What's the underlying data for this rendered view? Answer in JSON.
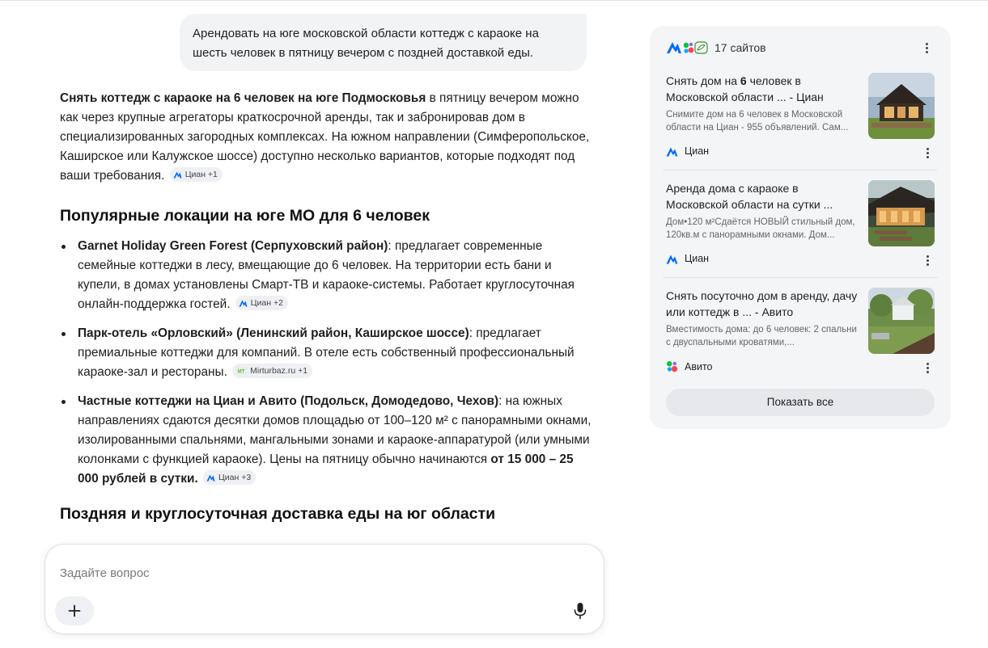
{
  "user_message": "Арендовать на юге московской области коттедж с караоке на шесть человек в пятницу вечером с поздней доставкой еды.",
  "answer": {
    "intro_bold": "Снять коттедж с караоке на 6 человек на юге Подмосковья",
    "intro_text": " в пятницу вечером можно как через крупные агрегаторы краткосрочной аренды, так и забронировав дом в специализированных загородных комплексах. На южном направлении (Симферопольское, Каширское или Калужское шоссе) доступно несколько вариантов, которые подходят под ваши требования.",
    "intro_chip": "Циан +1",
    "section1_title": "Популярные локации на юге МО для 6 человек",
    "items": [
      {
        "bold": "Garnet Holiday Green Forest (Серпуховский район)",
        "text": ": предлагает современные семейные коттеджи в лесу, вмещающие до 6 человек. На территории есть бани и купели, в домах установлены Смарт-ТВ и караоке-системы. Работает круглосуточная онлайн-поддержка гостей.",
        "chip": "Циан +2",
        "chip_icon": "cian-logo-icon"
      },
      {
        "bold": "Парк-отель «Орловский» (Ленинский район, Каширское шоссе)",
        "text": ": предлагает премиальные коттеджи для компаний. В отеле есть собственный профессиональный караоке-зал и рестораны.",
        "chip": "Mirturbaz.ru +1",
        "chip_icon": "mirturbaz-logo-icon"
      },
      {
        "bold": "Частные коттеджи на Циан и Авито (Подольск, Домодедово, Чехов)",
        "text": ": на южных направлениях сдаются десятки домов площадью от 100–120 м² с панорамными окнами, изолированными спальнями, мангальными зонами и караоке-аппаратурой (или умными колонками с функцией караоке). Цены на пятницу обычно начинаются ",
        "bold2": "от 15 000 – 25 000 рублей в сутки.",
        "chip": "Циан +3",
        "chip_icon": "cian-logo-icon"
      }
    ],
    "section2_title": "Поздняя и круглосуточная доставка еды на юг области"
  },
  "sources": {
    "count_label": "17 сайтов",
    "items": [
      {
        "title_pre": "Снять дом на ",
        "title_bold": "6",
        "title_post": " человек в Московской области ... - Циан",
        "desc": "Снимите дом на 6 человек в Московской области на Циан - 955 объявлений. Сам...",
        "site": "Циан",
        "site_icon": "cian-logo-icon"
      },
      {
        "title_pre": "Аренда дома с караоке в Московской области на сутки ...",
        "title_bold": "",
        "title_post": "",
        "desc": "Дом•120 м²Сдаётся НОВЫЙ стильный дом, 120кв.м с панорамными окнами. Дом...",
        "site": "Циан",
        "site_icon": "cian-logo-icon"
      },
      {
        "title_pre": "Снять посуточно дом в аренду, дачу или коттедж в ... - Авито",
        "title_bold": "",
        "title_post": "",
        "desc": "Вместимость дома: до 6 человек: 2 спальни с двуспальными кроватями,...",
        "site": "Авито",
        "site_icon": "avito-logo-icon"
      }
    ],
    "show_all_label": "Показать все"
  },
  "input": {
    "placeholder": "Задайте вопрос",
    "value": ""
  },
  "colors": {
    "cian_blue": "#0468ff",
    "avito_green": "#00c43a",
    "avito_blue": "#0af",
    "avito_purple": "#965eeb",
    "avito_red": "#ff4053"
  }
}
